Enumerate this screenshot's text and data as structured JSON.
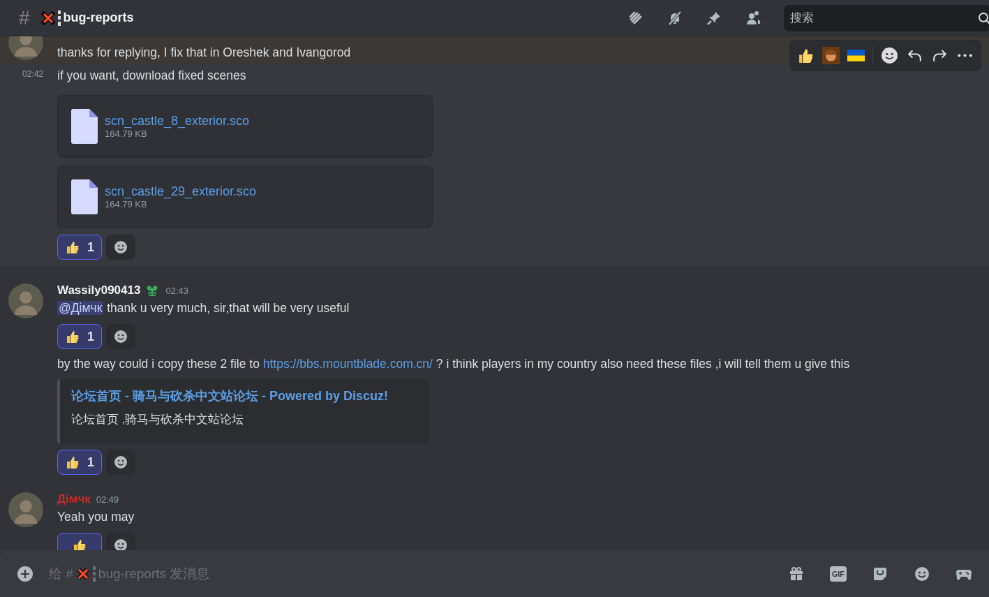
{
  "header": {
    "hash": "#",
    "channel_name": "bug-reports",
    "search": {
      "placeholder": "搜索"
    }
  },
  "messages": [
    {
      "kind": "continued",
      "highlighted": true,
      "text": "thanks for replying, I fix that in Oreshek and Ivangorod",
      "toolbar": true
    },
    {
      "kind": "followup",
      "hovered": true,
      "time": "02:42",
      "text": "if you want, download fixed scenes",
      "attachments": [
        {
          "name": "scn_castle_8_exterior.sco",
          "size": "164.79 KB"
        },
        {
          "name": "scn_castle_29_exterior.sco",
          "size": "164.79 KB"
        }
      ],
      "reactions": [
        {
          "count": "1",
          "selected": true
        }
      ]
    },
    {
      "kind": "full",
      "author": "Wassily090413",
      "color": "#f2f3f5",
      "badge": true,
      "time": "02:43",
      "mention": "@Дімчк",
      "text": "thank u very much, sir,that will be very useful",
      "reactions": [
        {
          "count": "1",
          "selected": true
        }
      ]
    },
    {
      "kind": "followup",
      "text": "by the way could i copy these 2 file to",
      "link": "https://bbs.mountblade.com.cn/",
      "text_after": "? i think players in my country also need these files ,i will tell them u give this",
      "embed": {
        "title": "论坛首页 - 骑马与砍杀中文站论坛 - Powered by Discuz!",
        "description": "论坛首页 ,骑马与砍杀中文站论坛"
      },
      "reactions": [
        {
          "count": "1",
          "selected": true
        }
      ]
    },
    {
      "kind": "full",
      "author": "Дімчк",
      "color": "#c22b2b",
      "time": "02:49",
      "text": "Yeah you may",
      "reactions": [
        {
          "selected": true
        }
      ]
    }
  ],
  "composer": {
    "prefix": "给 #",
    "suffix": "bug-reports 发消息"
  },
  "composer_tools": [
    {
      "kind": "gift"
    },
    {
      "kind": "gif",
      "label": "GIF"
    },
    {
      "kind": "sticker"
    },
    {
      "kind": "emoji"
    },
    {
      "kind": "game"
    }
  ]
}
